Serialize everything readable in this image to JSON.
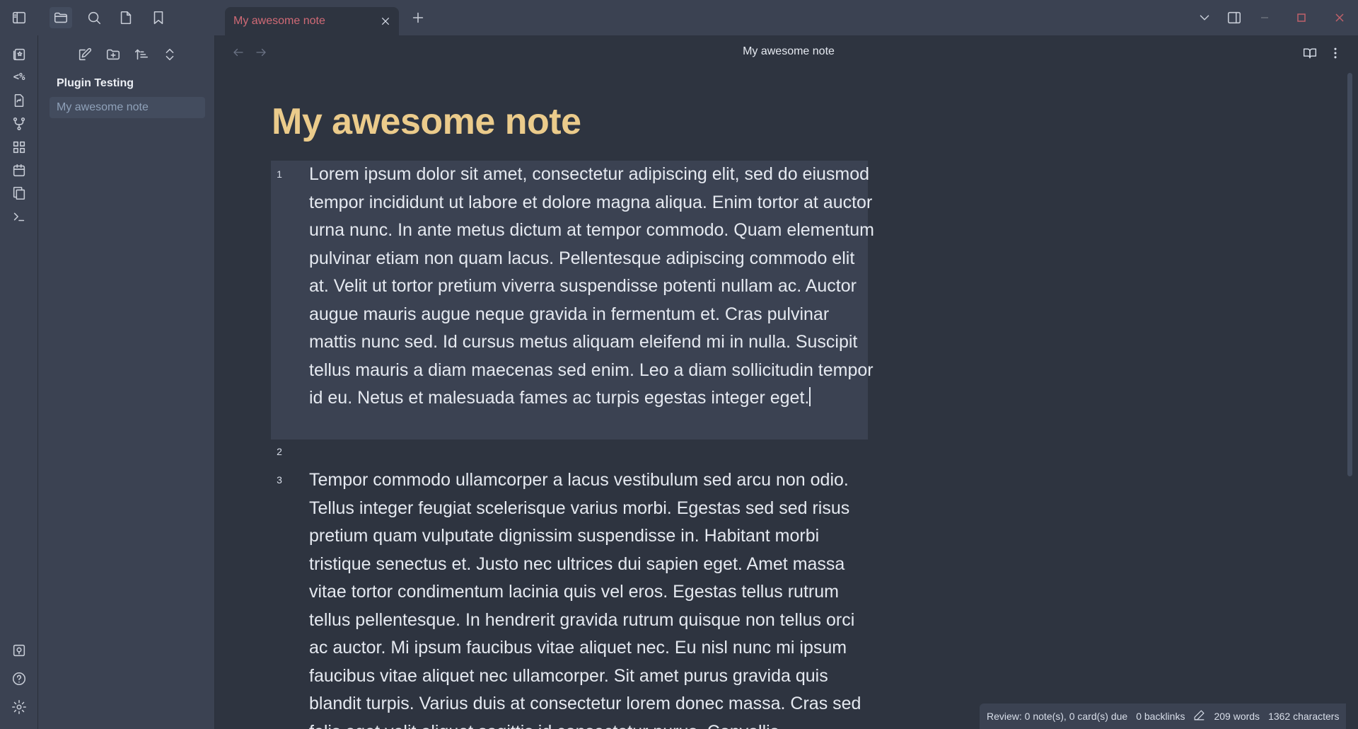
{
  "tabs": [
    {
      "title": "My awesome note",
      "active": true
    }
  ],
  "sidebar": {
    "vault_name": "Plugin Testing",
    "files": [
      {
        "name": "My awesome note",
        "active": true
      }
    ]
  },
  "ribbon": {
    "code_label": "<%"
  },
  "view": {
    "header_title": "My awesome note",
    "note_title": "My awesome note",
    "lines": [
      {
        "number": "1",
        "text": "Lorem ipsum dolor sit amet, consectetur adipiscing elit, sed do eiusmod tempor incididunt ut labore et dolore magna aliqua. Enim tortor at auctor urna nunc. In ante metus dictum at tempor commodo. Quam elementum pulvinar etiam non quam lacus. Pellentesque adipiscing commodo elit at. Velit ut tortor pretium viverra suspendisse potenti nullam ac. Auctor augue mauris augue neque gravida in fermentum et. Cras pulvinar mattis nunc sed. Id cursus metus aliquam eleifend mi in nulla. Suscipit tellus mauris a diam maecenas sed enim. Leo a diam sollicitudin tempor id eu. Netus et malesuada fames ac turpis egestas integer eget."
      },
      {
        "number": "2",
        "text": ""
      },
      {
        "number": "3",
        "text": "Tempor commodo ullamcorper a lacus vestibulum sed arcu non odio. Tellus integer feugiat scelerisque varius morbi. Egestas sed sed risus pretium quam vulputate dignissim suspendisse in. Habitant morbi tristique senectus et. Justo nec ultrices dui sapien eget. Amet massa vitae tortor condimentum lacinia quis vel eros. Egestas tellus rutrum tellus pellentesque. In hendrerit gravida rutrum quisque non tellus orci ac auctor. Mi ipsum faucibus vitae aliquet nec. Eu nisl nunc mi ipsum faucibus vitae aliquet nec ullamcorper. Sit amet purus gravida quis blandit turpis. Varius duis at consectetur lorem donec massa. Cras sed felis eget velit aliquet sagittis id consectetur purus. Convallis"
      }
    ]
  },
  "status": {
    "review": "Review: 0 note(s), 0 card(s) due",
    "backlinks": "0 backlinks",
    "words": "209 words",
    "characters": "1362 characters"
  },
  "colors": {
    "background": "#2e3440",
    "panel": "#3b4252",
    "title_accent": "#ebcb8b",
    "tab_title": "#d06a76",
    "window_close": "#bf616a",
    "window_maximize": "#bf616a"
  }
}
